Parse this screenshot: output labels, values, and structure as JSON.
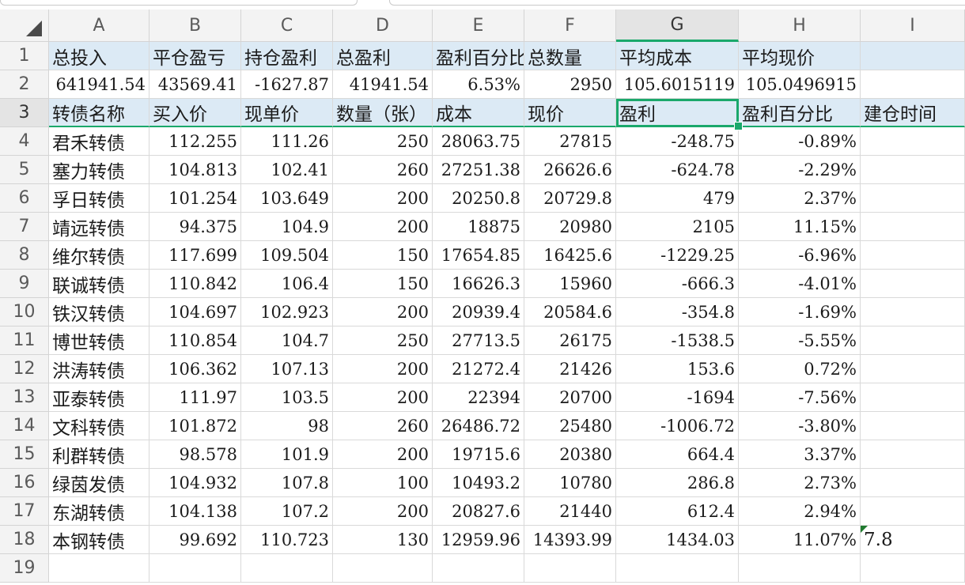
{
  "columns": [
    "A",
    "B",
    "C",
    "D",
    "E",
    "F",
    "G",
    "H",
    "I"
  ],
  "rows": [
    "1",
    "2",
    "3",
    "4",
    "5",
    "6",
    "7",
    "8",
    "9",
    "10",
    "11",
    "12",
    "13",
    "14",
    "15",
    "16",
    "17",
    "18",
    "19"
  ],
  "summary_headers": [
    "总投入",
    "平仓盈亏",
    "持仓盈利",
    "总盈利",
    "盈利百分比",
    "总数量",
    "平均成本",
    "平均现价",
    ""
  ],
  "summary_values": [
    "641941.54",
    "43569.41",
    "-1627.87",
    "41941.54",
    "6.53%",
    "2950",
    "105.6015119",
    "105.0496915",
    ""
  ],
  "table_headers": [
    "转债名称",
    "买入价",
    "现单价",
    "数量（张）",
    "成本",
    "现价",
    "盈利",
    "盈利百分比",
    "建仓时间"
  ],
  "data_rows": [
    [
      "君禾转债",
      "112.255",
      "111.26",
      "250",
      "28063.75",
      "27815",
      "-248.75",
      "-0.89%",
      ""
    ],
    [
      "塞力转债",
      "104.813",
      "102.41",
      "260",
      "27251.38",
      "26626.6",
      "-624.78",
      "-2.29%",
      ""
    ],
    [
      "孚日转债",
      "101.254",
      "103.649",
      "200",
      "20250.8",
      "20729.8",
      "479",
      "2.37%",
      ""
    ],
    [
      "靖远转债",
      "94.375",
      "104.9",
      "200",
      "18875",
      "20980",
      "2105",
      "11.15%",
      ""
    ],
    [
      "维尔转债",
      "117.699",
      "109.504",
      "150",
      "17654.85",
      "16425.6",
      "-1229.25",
      "-6.96%",
      ""
    ],
    [
      "联诚转债",
      "110.842",
      "106.4",
      "150",
      "16626.3",
      "15960",
      "-666.3",
      "-4.01%",
      ""
    ],
    [
      "铁汉转债",
      "104.697",
      "102.923",
      "200",
      "20939.4",
      "20584.6",
      "-354.8",
      "-1.69%",
      ""
    ],
    [
      "博世转债",
      "110.854",
      "104.7",
      "250",
      "27713.5",
      "26175",
      "-1538.5",
      "-5.55%",
      ""
    ],
    [
      "洪涛转债",
      "106.362",
      "107.13",
      "200",
      "21272.4",
      "21426",
      "153.6",
      "0.72%",
      ""
    ],
    [
      "亚泰转债",
      "111.97",
      "103.5",
      "200",
      "22394",
      "20700",
      "-1694",
      "-7.56%",
      ""
    ],
    [
      "文科转债",
      "101.872",
      "98",
      "260",
      "26486.72",
      "25480",
      "-1006.72",
      "-3.80%",
      ""
    ],
    [
      "利群转债",
      "98.578",
      "101.9",
      "200",
      "19715.6",
      "20380",
      "664.4",
      "3.37%",
      ""
    ],
    [
      "绿茵发债",
      "104.932",
      "107.8",
      "100",
      "10493.2",
      "10780",
      "286.8",
      "2.73%",
      ""
    ],
    [
      "东湖转债",
      "104.138",
      "107.2",
      "200",
      "20827.6",
      "21440",
      "612.4",
      "2.94%",
      ""
    ],
    [
      "本钢转债",
      "99.692",
      "110.723",
      "130",
      "12959.96",
      "14393.99",
      "1434.03",
      "11.07%",
      "7.8"
    ],
    [
      "",
      "",
      "",
      "",
      "",
      "",
      "",
      "",
      ""
    ]
  ],
  "selected_cell": "G3",
  "colors": {
    "header_band": "#dceaf5",
    "selection": "#1aa86b",
    "flag": "#1f7a2e"
  }
}
